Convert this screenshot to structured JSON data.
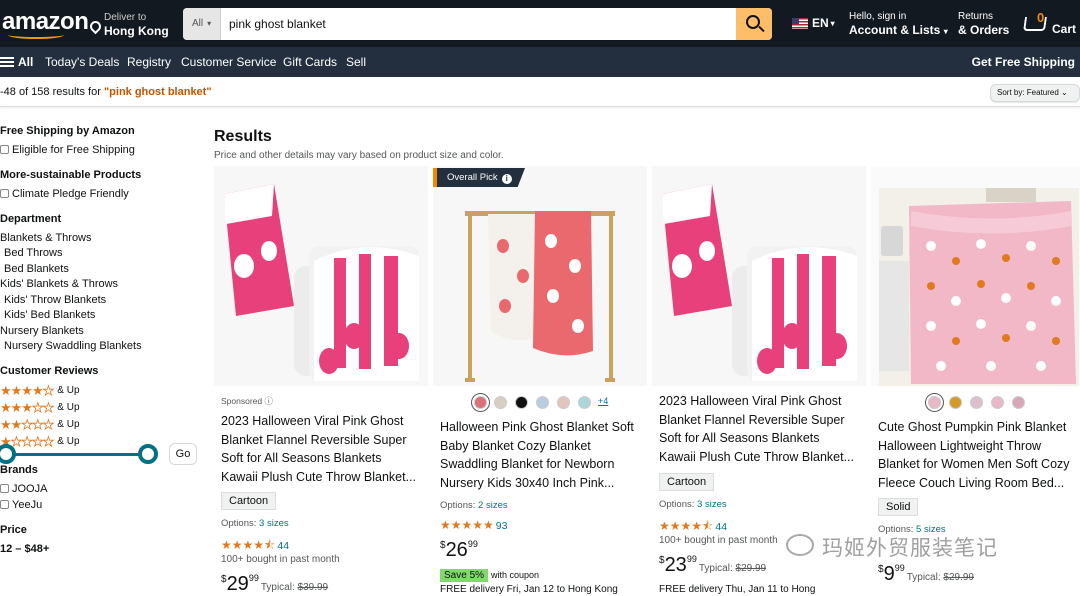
{
  "header": {
    "logo": "amazon",
    "deliver_to": "Deliver to",
    "location": "Hong Kong",
    "search_category": "All",
    "search_value": "pink ghost blanket",
    "language": "EN",
    "account_line1": "Hello, sign in",
    "account_line2": "Account & Lists",
    "returns_line1": "Returns",
    "returns_line2": "& Orders",
    "cart_count": "0",
    "cart_label": "Cart"
  },
  "nav": {
    "all": "All",
    "items": [
      "Today's Deals",
      "Registry",
      "Customer Service",
      "Gift Cards",
      "Sell"
    ],
    "promo": "Get Free Shipping"
  },
  "results_bar": {
    "count_text": "-48 of 158 results for ",
    "query": "\"pink ghost blanket\"",
    "sort": "Sort by: Featured"
  },
  "sidebar": {
    "free_shipping_heading": "Free Shipping by Amazon",
    "free_shipping_option": "Eligible for Free Shipping",
    "sustainable_heading": "More-sustainable Products",
    "sustainable_option": "Climate Pledge Friendly",
    "department_heading": "Department",
    "departments": [
      "Blankets & Throws",
      "Bed Throws",
      "Bed Blankets",
      "Kids' Blankets & Throws",
      "Kids' Throw Blankets",
      "Kids' Bed Blankets",
      "Nursery Blankets",
      "Nursery Swaddling Blankets"
    ],
    "reviews_heading": "Customer Reviews",
    "review_up": "& Up",
    "review_levels": [
      4,
      3,
      2,
      1
    ],
    "brands_heading": "Brands",
    "brands": [
      "JOOJA",
      "YeeJu"
    ],
    "price_heading": "Price",
    "price_range": "12 – $48+",
    "go": "Go"
  },
  "main": {
    "title": "Results",
    "subtitle": "Price and other details may vary based on product size and color."
  },
  "products": [
    {
      "sponsored": "Sponsored",
      "title": "2023 Halloween Viral Pink Ghost Blanket Flannel Reversible Super Soft for All Seasons Blankets Kawaii Plush Cute Throw Blanket...",
      "badge": "Cartoon",
      "options_label": "Options:",
      "options_value": "3 sizes",
      "rating": 4.5,
      "reviews": "44",
      "bought": "100+ bought in past month",
      "price_whole": "29",
      "price_frac": "99",
      "typical_label": "Typical:",
      "typical_price": "$39.99"
    },
    {
      "overall_pick": "Overall Pick",
      "swatch_colors": [
        "#d9707a",
        "#d8cfc4",
        "#111111",
        "#b9cde0",
        "#e5c4bd",
        "#a9d8d6"
      ],
      "more_swatches": "+4",
      "title": "Halloween Pink Ghost Blanket Soft Baby Blanket Cozy Blanket Swaddling Blanket for Newborn Nursery Kids 30x40 Inch Pink...",
      "options_label": "Options:",
      "options_value": "2 sizes",
      "rating": 4.8,
      "reviews": "93",
      "price_whole": "26",
      "price_frac": "99",
      "save": "Save 5%",
      "coupon": "with coupon",
      "delivery": "FREE delivery Fri, Jan 12 to Hong Kong"
    },
    {
      "title": "2023 Halloween Viral Pink Ghost Blanket Flannel Reversible Super Soft for All Seasons Blankets Kawaii Plush Cute Throw Blanket...",
      "badge": "Cartoon",
      "options_label": "Options:",
      "options_value": "3 sizes",
      "rating": 4.5,
      "reviews": "44",
      "bought": "100+ bought in past month",
      "price_whole": "23",
      "price_frac": "99",
      "typical_label": "Typical:",
      "typical_price": "$29.99",
      "delivery": "FREE delivery Thu, Jan 11 to Hong"
    },
    {
      "swatch_colors": [
        "#e8b9c4",
        "#d49a2a",
        "#dcc1cc",
        "#e6b8c8",
        "#d8a7b8"
      ],
      "title": "Cute Ghost Pumpkin Pink Blanket Halloween Lightweight Throw Blanket for Women Men Soft Cozy Fleece Couch Living Room Bed...",
      "badge": "Solid",
      "options_label": "Options:",
      "options_value": "5 sizes",
      "price_whole": "9",
      "price_frac": "99",
      "typical_label": "Typical:",
      "typical_price": "$29.99"
    }
  ],
  "watermark": "玛姬外贸服装笔记",
  "colors": {
    "topbar": "#131921",
    "navbar": "#232f3e",
    "search_button": "#febd69",
    "query_accent": "#c45500",
    "link": "#007185",
    "star": "#de7921",
    "save_badge": "#7fda69",
    "blanket_pink": "#e8407a"
  }
}
